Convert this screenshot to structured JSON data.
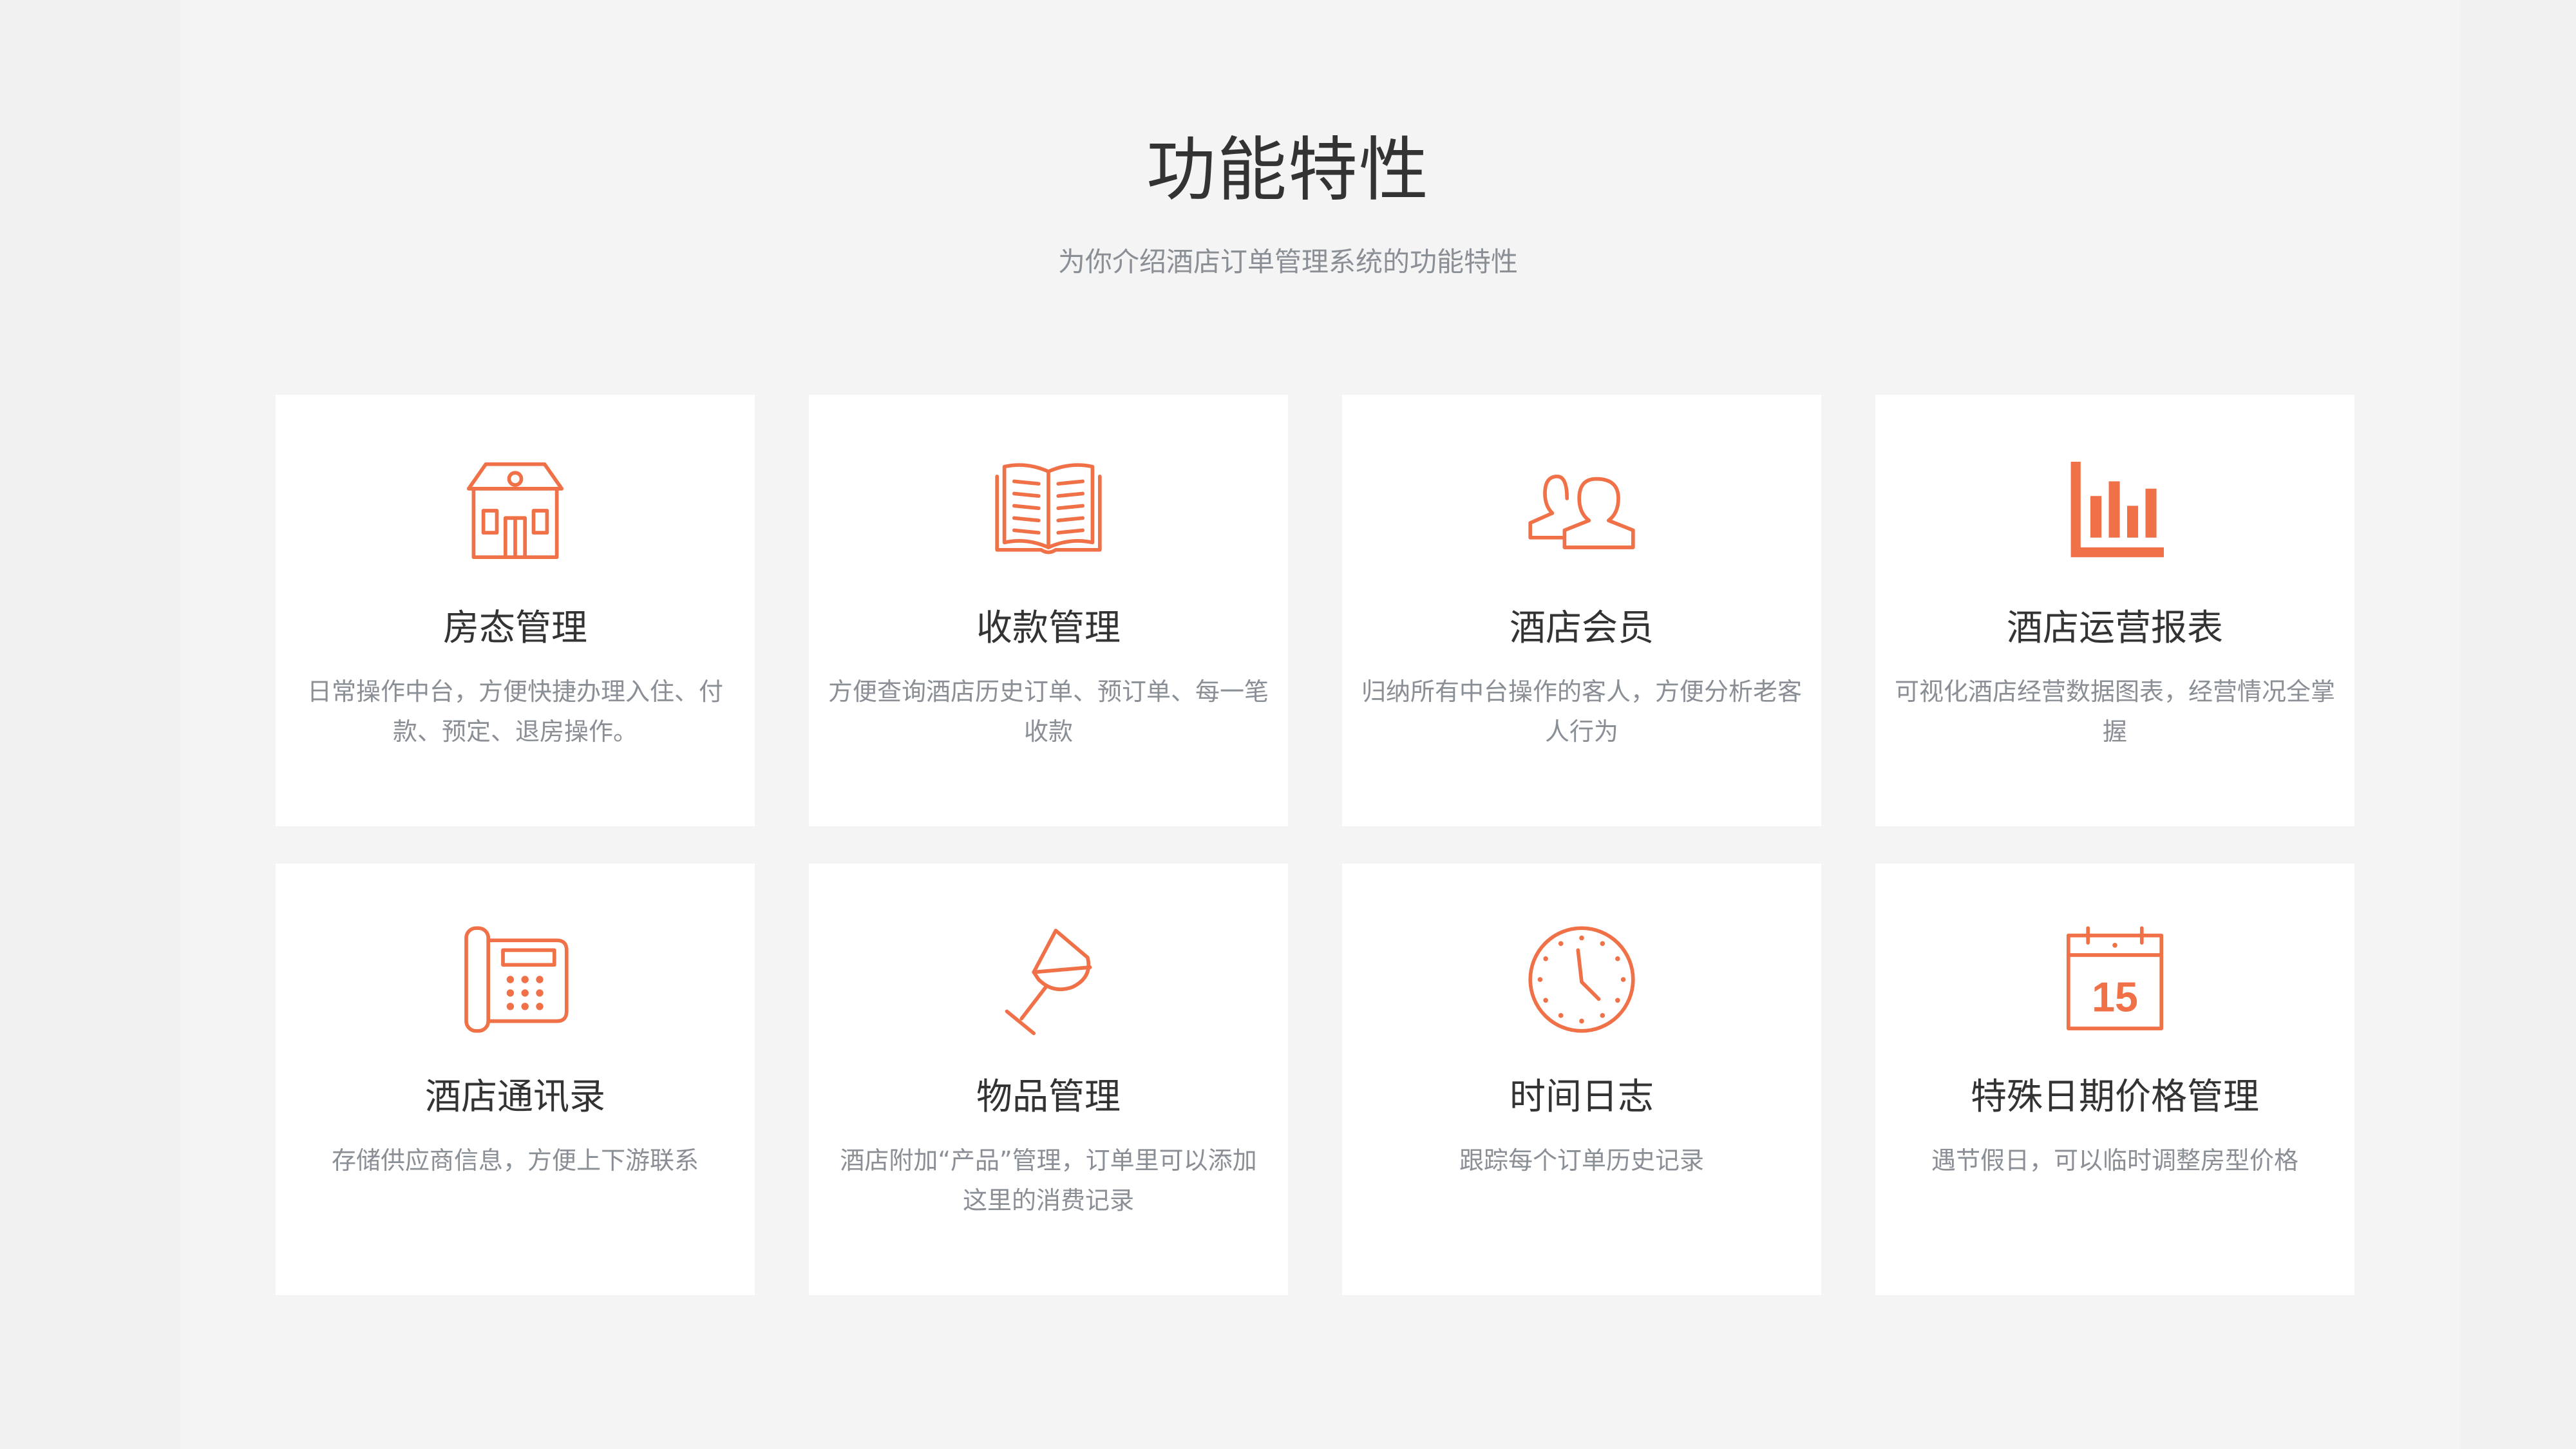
{
  "section": {
    "title": "功能特性",
    "subtitle": "为你介绍酒店订单管理系统的功能特性"
  },
  "accent_color": "#f07148",
  "features": [
    {
      "icon": "house-icon",
      "title": "房态管理",
      "desc": "日常操作中台，方便快捷办理入住、付款、预定、退房操作。"
    },
    {
      "icon": "book-icon",
      "title": "收款管理",
      "desc": "方便查询酒店历史订单、预订单、每一笔收款"
    },
    {
      "icon": "users-icon",
      "title": "酒店会员",
      "desc": "归纳所有中台操作的客人，方便分析老客人行为"
    },
    {
      "icon": "bar-chart-icon",
      "title": "酒店运营报表",
      "desc": "可视化酒店经营数据图表，经营情况全掌握"
    },
    {
      "icon": "telephone-icon",
      "title": "酒店通讯录",
      "desc": "存储供应商信息，方便上下游联系"
    },
    {
      "icon": "wine-glass-icon",
      "title": "物品管理",
      "desc": "酒店附加“产品”管理，订单里可以添加这里的消费记录"
    },
    {
      "icon": "clock-icon",
      "title": "时间日志",
      "desc": "跟踪每个订单历史记录"
    },
    {
      "icon": "calendar-icon",
      "title": "特殊日期价格管理",
      "desc": "遇节假日，可以临时调整房型价格",
      "calendar_day": "15"
    }
  ]
}
